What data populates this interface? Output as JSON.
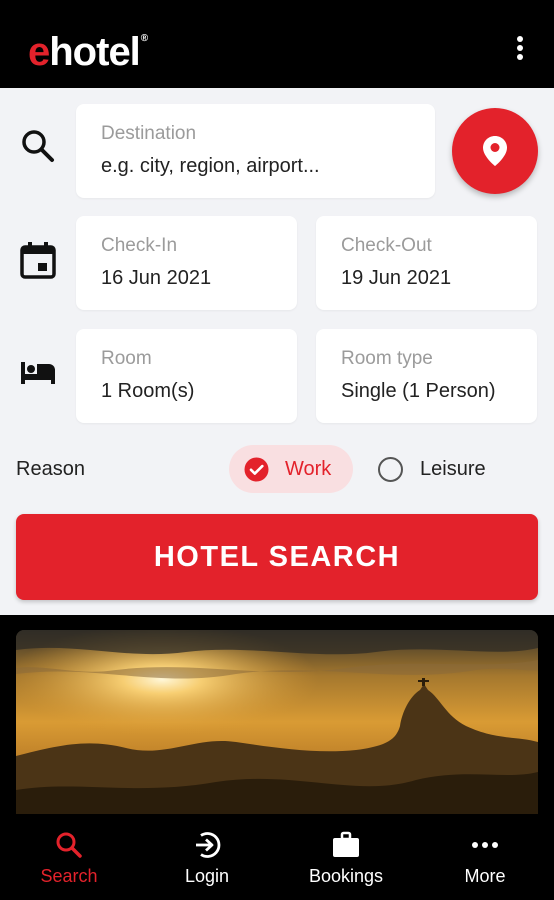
{
  "app": {
    "logo_e": "e",
    "logo_rest": "hotel",
    "logo_reg": "®"
  },
  "search": {
    "destination_label": "Destination",
    "destination_placeholder": "e.g. city, region, airport...",
    "checkin_label": "Check-In",
    "checkin_value": "16 Jun 2021",
    "checkout_label": "Check-Out",
    "checkout_value": "19 Jun 2021",
    "room_label": "Room",
    "room_value": "1 Room(s)",
    "roomtype_label": "Room type",
    "roomtype_value": "Single (1 Person)",
    "reason_label": "Reason",
    "reason_work": "Work",
    "reason_leisure": "Leisure",
    "reason_selected": "Work",
    "button_label": "HOTEL SEARCH"
  },
  "nav": {
    "items": [
      {
        "label": "Search",
        "icon": "search-icon",
        "active": true
      },
      {
        "label": "Login",
        "icon": "login-icon",
        "active": false
      },
      {
        "label": "Bookings",
        "icon": "briefcase-icon",
        "active": false
      },
      {
        "label": "More",
        "icon": "more-icon",
        "active": false
      }
    ]
  },
  "colors": {
    "accent": "#e3222b",
    "background": "#f2f3f6",
    "bar": "#000000"
  }
}
